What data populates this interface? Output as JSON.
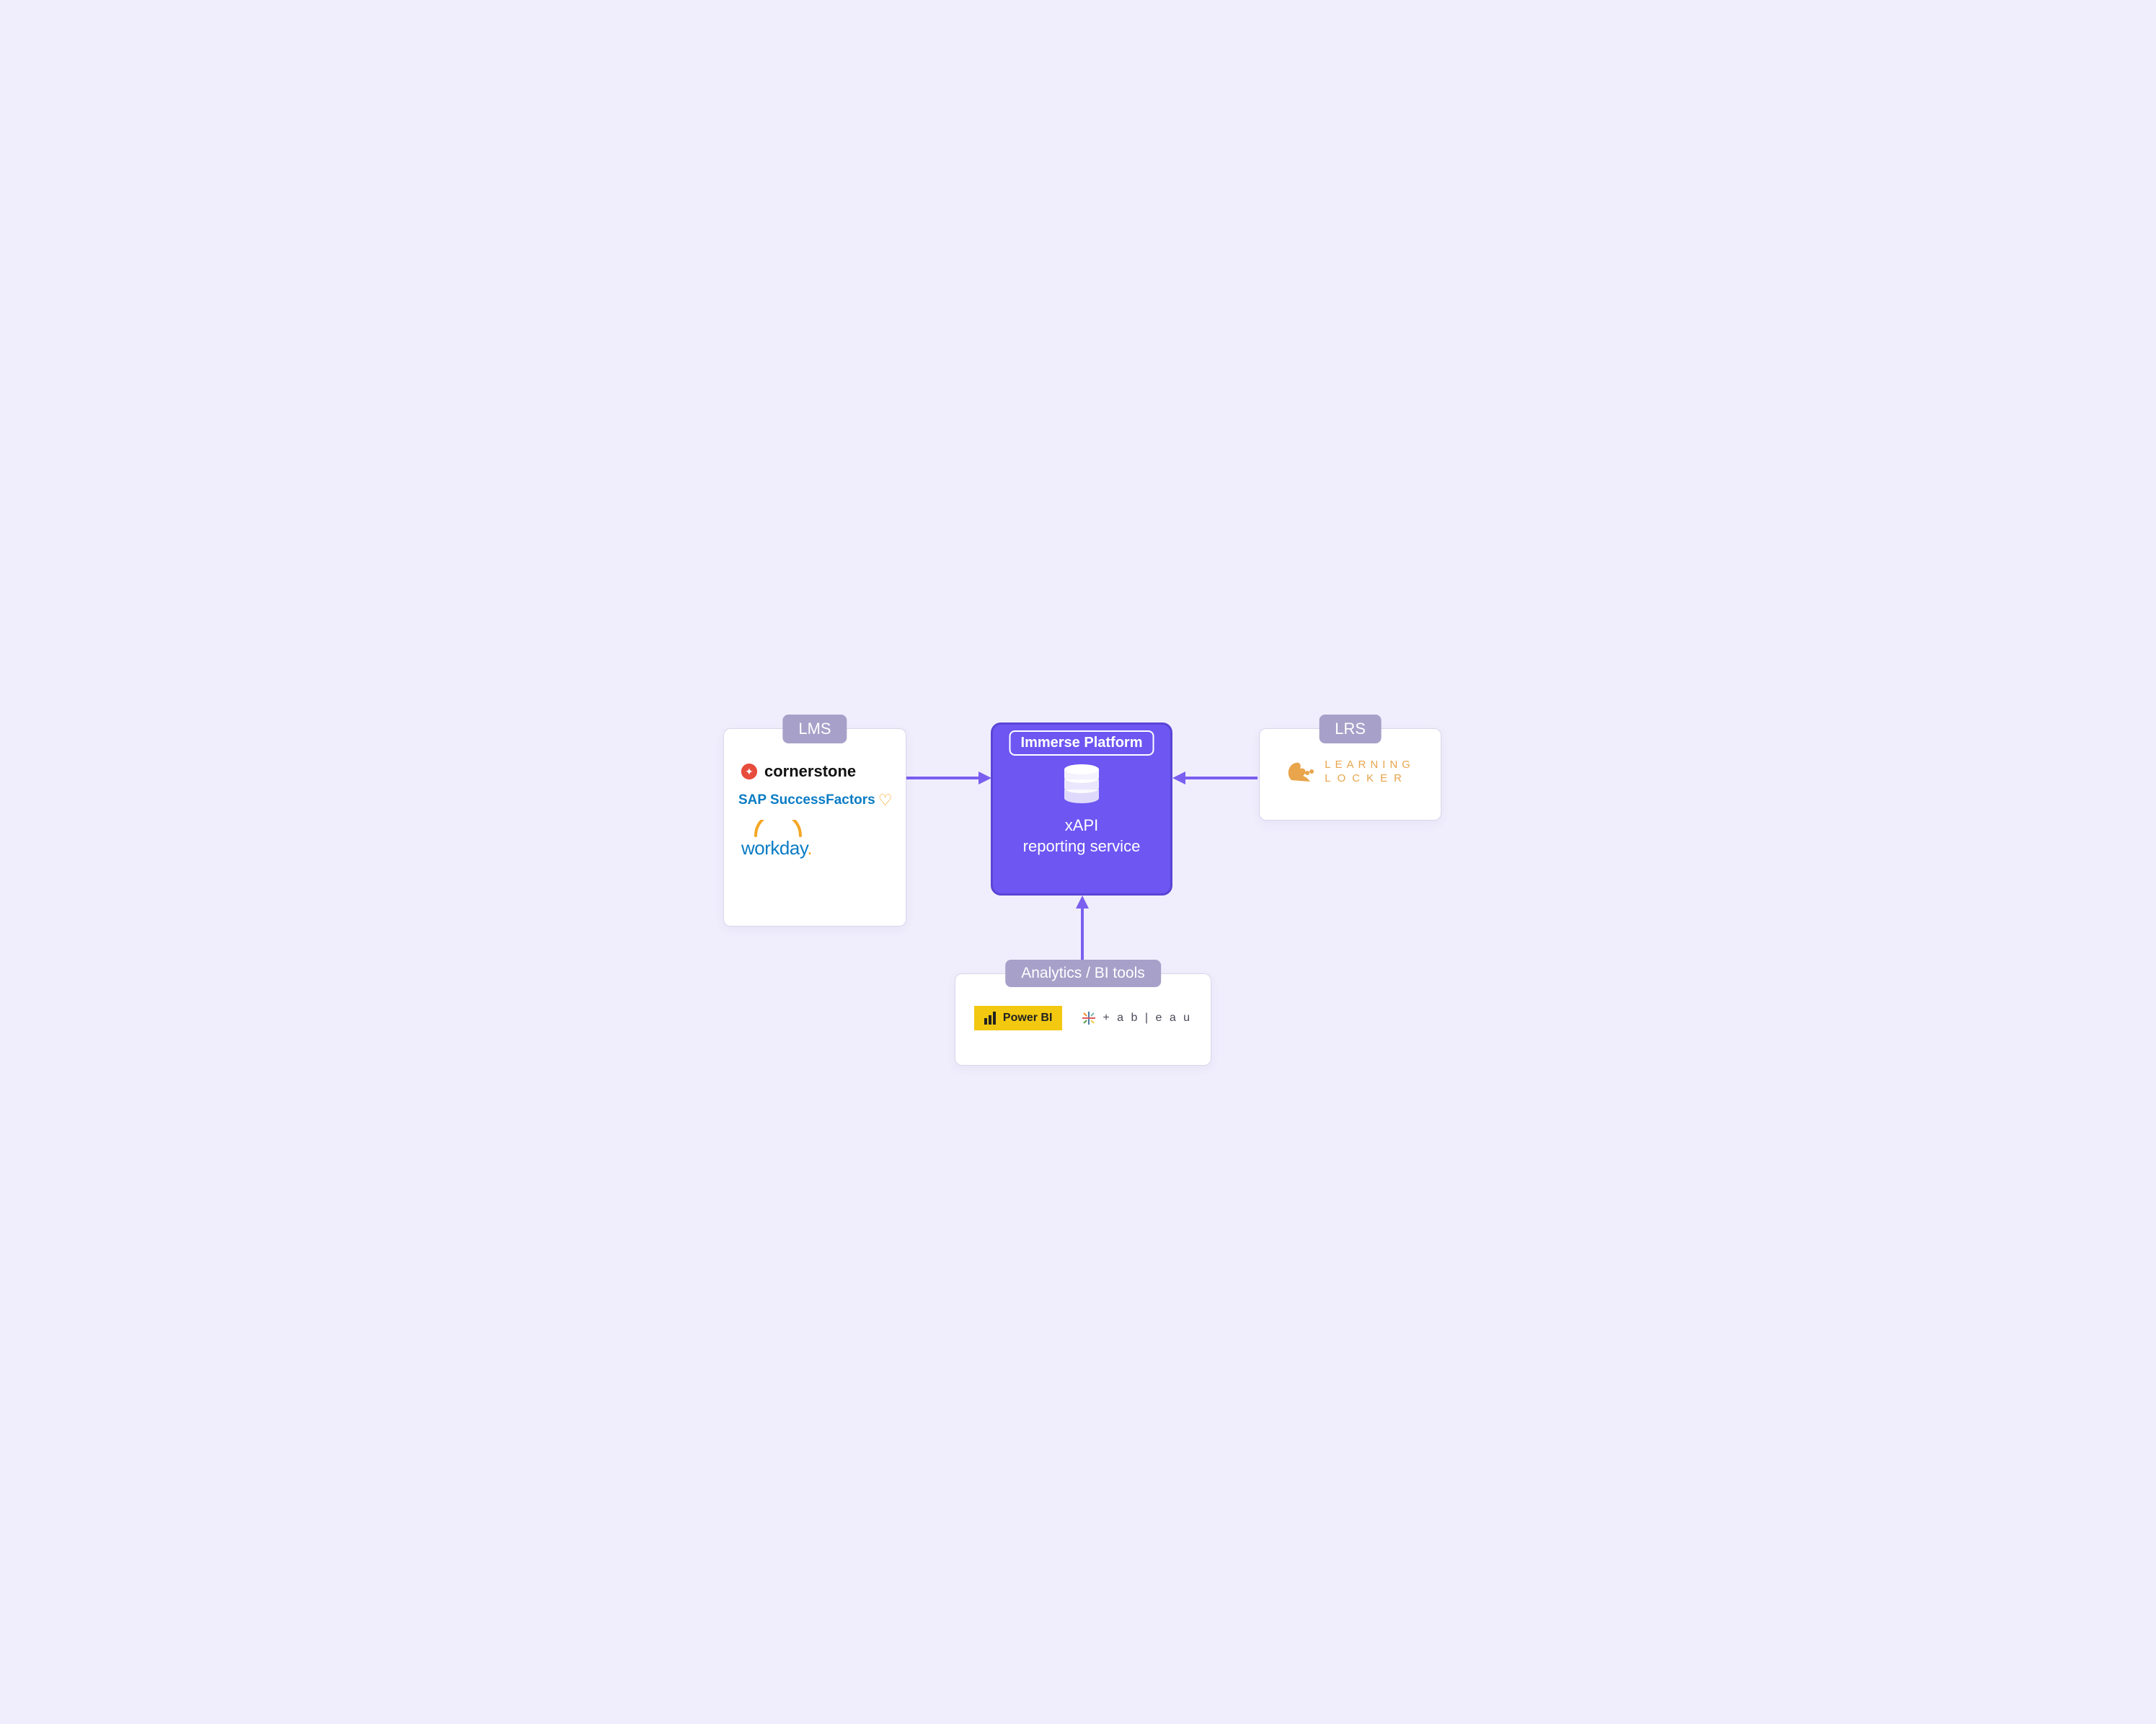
{
  "center": {
    "header": "Immerse Platform",
    "title_line1": "xAPI",
    "title_line2": "reporting service"
  },
  "lms": {
    "header": "LMS",
    "vendors": {
      "cornerstone": "cornerstone",
      "sap": "SAP SuccessFactors",
      "workday": "workday"
    }
  },
  "lrs": {
    "header": "LRS",
    "vendor_line1": "LEARNING",
    "vendor_line2": "LOCKER"
  },
  "bi": {
    "header": "Analytics / BI tools",
    "powerbi": "Power BI",
    "tableau": "t a b l e a u"
  }
}
